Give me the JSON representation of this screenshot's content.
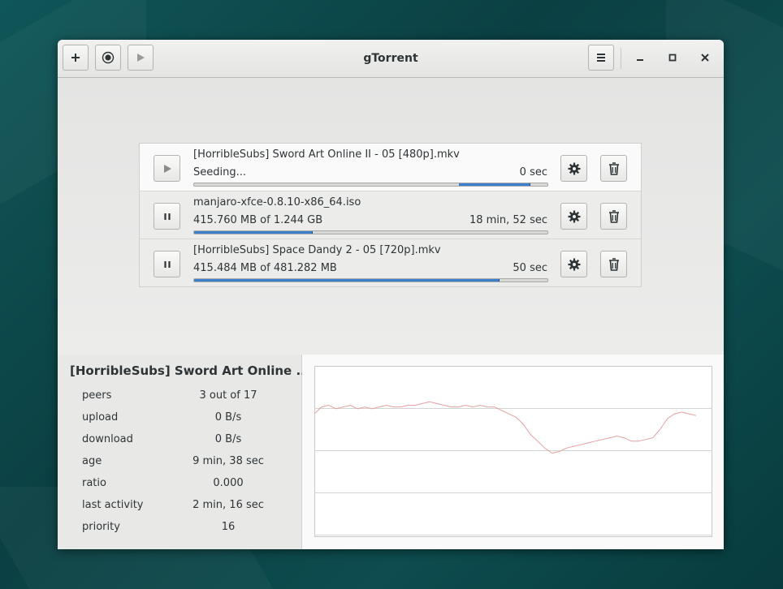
{
  "window": {
    "title": "gTorrent"
  },
  "toolbar": {
    "add_icon": "plus-icon",
    "magnet_icon": "record-icon",
    "resume_icon": "play-icon",
    "menu_icon": "hamburger-menu-icon"
  },
  "torrents": [
    {
      "name": "[HorribleSubs] Sword Art Online II - 05 [480p].mkv",
      "status": "Seeding...",
      "eta": "0 sec",
      "state_icon": "play-icon",
      "seeding": true,
      "progress": 1.0
    },
    {
      "name": "manjaro-xfce-0.8.10-x86_64.iso",
      "status": "415.760 MB of 1.244 GB",
      "eta": "18 min, 52 sec",
      "state_icon": "pause-icon",
      "seeding": false,
      "progress": 0.334
    },
    {
      "name": "[HorribleSubs] Space Dandy 2 - 05 [720p].mkv",
      "status": "415.484 MB of 481.282 MB",
      "eta": "50 sec",
      "state_icon": "pause-icon",
      "seeding": false,
      "progress": 0.863
    }
  ],
  "details": {
    "title": "[HorribleSubs] Sword Art Online ...",
    "rows": [
      {
        "label": "peers",
        "value": "3 out of 17"
      },
      {
        "label": "upload",
        "value": "0 B/s"
      },
      {
        "label": "download",
        "value": "0 B/s"
      },
      {
        "label": "age",
        "value": "9 min, 38 sec"
      },
      {
        "label": "ratio",
        "value": "0.000"
      },
      {
        "label": "last activity",
        "value": "2 min, 16 sec"
      },
      {
        "label": "priority",
        "value": "16"
      }
    ]
  },
  "graph": {
    "line_color": "#e8a0a0",
    "series": [
      0.72,
      0.76,
      0.77,
      0.75,
      0.76,
      0.77,
      0.75,
      0.76,
      0.75,
      0.76,
      0.77,
      0.76,
      0.76,
      0.77,
      0.77,
      0.78,
      0.79,
      0.78,
      0.77,
      0.76,
      0.76,
      0.77,
      0.76,
      0.77,
      0.76,
      0.76,
      0.74,
      0.72,
      0.7,
      0.66,
      0.6,
      0.56,
      0.52,
      0.49,
      0.5,
      0.52,
      0.53,
      0.54,
      0.55,
      0.56,
      0.57,
      0.58,
      0.59,
      0.58,
      0.56,
      0.56,
      0.57,
      0.58,
      0.63,
      0.69,
      0.72,
      0.73,
      0.72,
      0.71
    ]
  }
}
